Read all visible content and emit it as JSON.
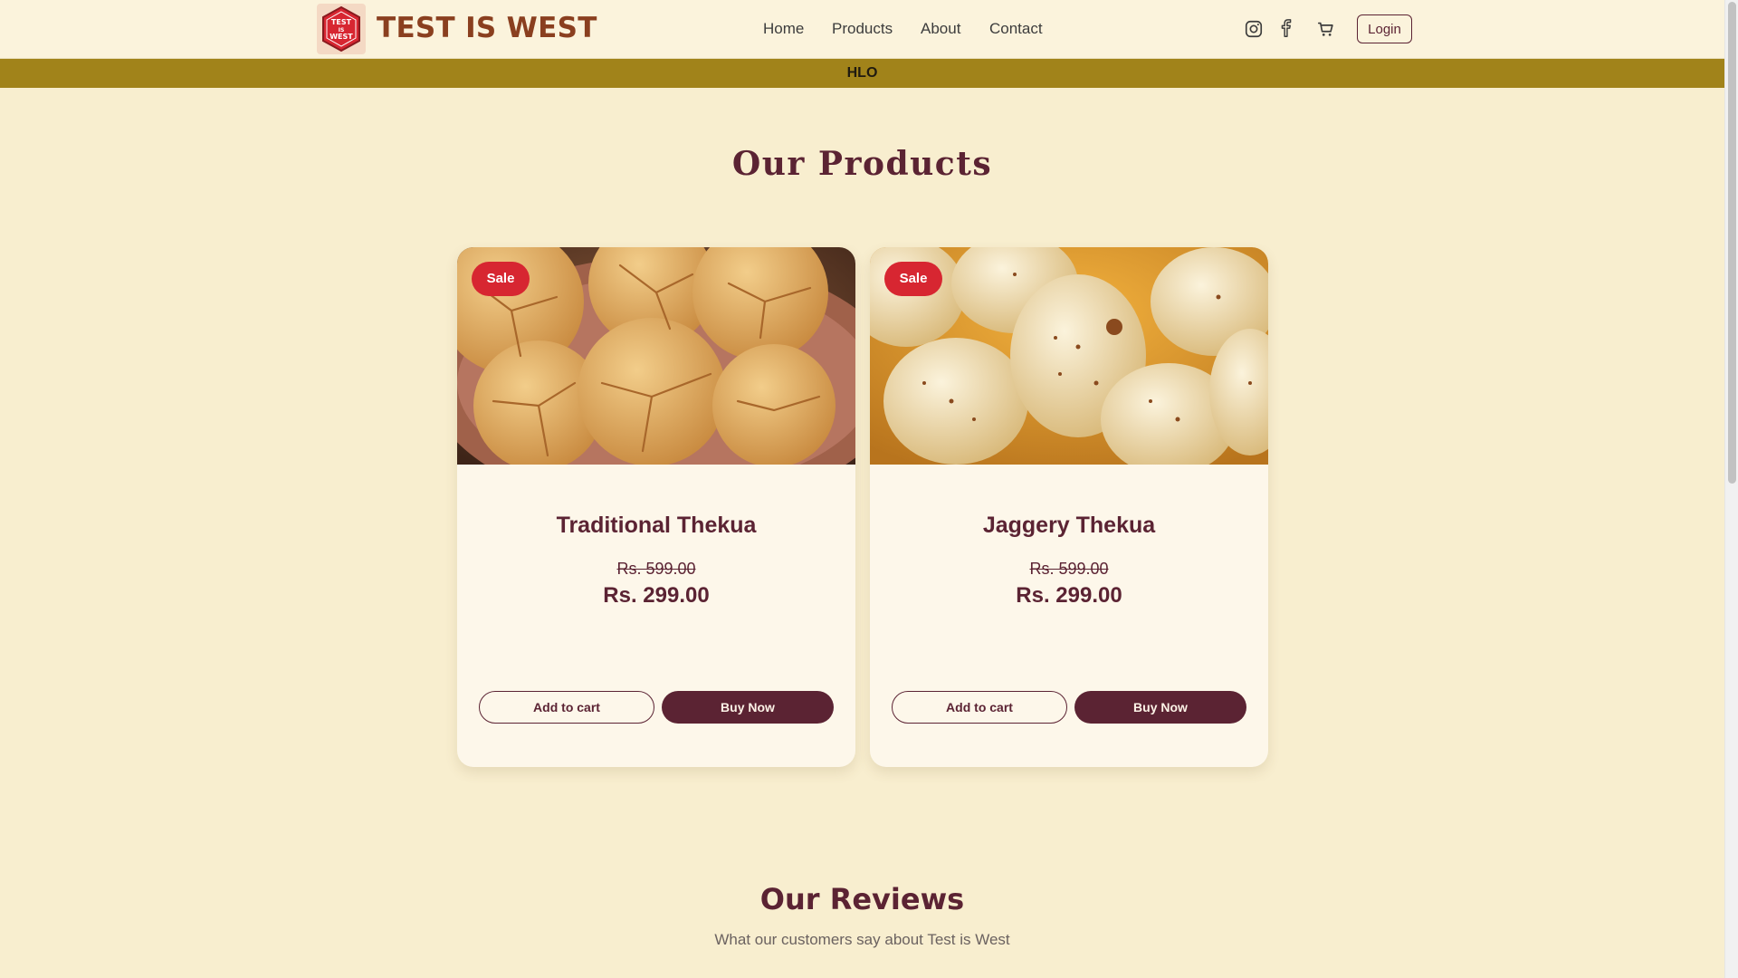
{
  "header": {
    "brand": "TEST IS WEST",
    "logo_text_top": "TEST",
    "logo_text_mid": "IS",
    "logo_text_bottom": "WEST",
    "nav": [
      "Home",
      "Products",
      "About",
      "Contact"
    ],
    "icons": [
      "instagram-icon",
      "facebook-icon",
      "cart-icon"
    ],
    "login_label": "Login"
  },
  "announcement": "HLO",
  "products_section": {
    "title": "Our Products",
    "items": [
      {
        "badge": "Sale",
        "name": "Traditional Thekua",
        "old_price": "Rs. 599.00",
        "price": "Rs. 299.00",
        "add_to_cart": "Add to cart",
        "buy_now": "Buy Now"
      },
      {
        "badge": "Sale",
        "name": "Jaggery Thekua",
        "old_price": "Rs. 599.00",
        "price": "Rs. 299.00",
        "add_to_cart": "Add to cart",
        "buy_now": "Buy Now"
      }
    ]
  },
  "reviews_section": {
    "title": "Our Reviews",
    "subtitle": "What our customers say about Test is West"
  },
  "colors": {
    "page_bg": "#f8eecf",
    "primary": "#5b2333",
    "brand": "#8a3f1f",
    "announce_bg": "#a1831a",
    "sale_badge": "#d72631"
  }
}
